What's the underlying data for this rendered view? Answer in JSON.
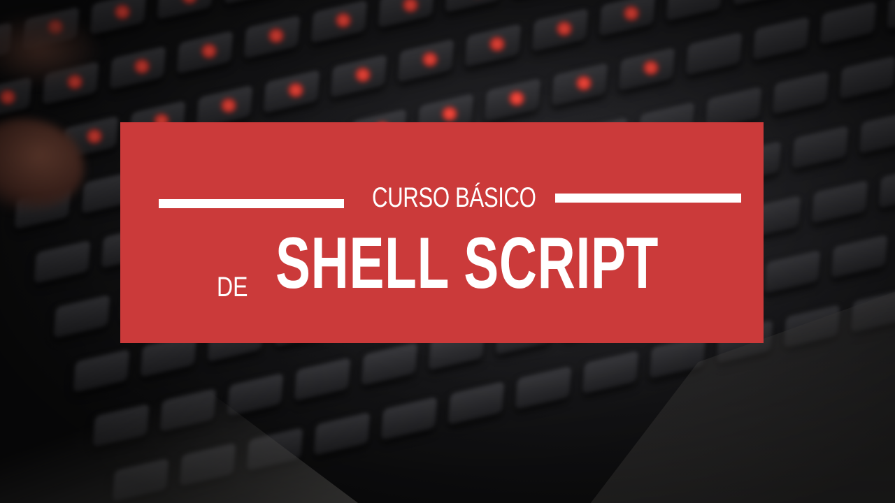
{
  "banner": {
    "subtitle": "CURSO BÁSICO",
    "prefix": "DE",
    "title": "SHELL SCRIPT",
    "color": "#cb3a3a"
  },
  "background": {
    "subject": "backlit-keyboard",
    "glow_color": "#e0332a"
  }
}
